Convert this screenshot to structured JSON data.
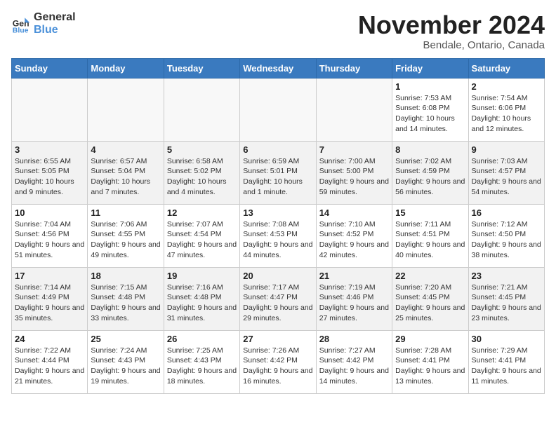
{
  "header": {
    "logo_line1": "General",
    "logo_line2": "Blue",
    "month_title": "November 2024",
    "location": "Bendale, Ontario, Canada"
  },
  "weekdays": [
    "Sunday",
    "Monday",
    "Tuesday",
    "Wednesday",
    "Thursday",
    "Friday",
    "Saturday"
  ],
  "weeks": [
    [
      {
        "day": "",
        "info": ""
      },
      {
        "day": "",
        "info": ""
      },
      {
        "day": "",
        "info": ""
      },
      {
        "day": "",
        "info": ""
      },
      {
        "day": "",
        "info": ""
      },
      {
        "day": "1",
        "info": "Sunrise: 7:53 AM\nSunset: 6:08 PM\nDaylight: 10 hours and 14 minutes."
      },
      {
        "day": "2",
        "info": "Sunrise: 7:54 AM\nSunset: 6:06 PM\nDaylight: 10 hours and 12 minutes."
      }
    ],
    [
      {
        "day": "3",
        "info": "Sunrise: 6:55 AM\nSunset: 5:05 PM\nDaylight: 10 hours and 9 minutes."
      },
      {
        "day": "4",
        "info": "Sunrise: 6:57 AM\nSunset: 5:04 PM\nDaylight: 10 hours and 7 minutes."
      },
      {
        "day": "5",
        "info": "Sunrise: 6:58 AM\nSunset: 5:02 PM\nDaylight: 10 hours and 4 minutes."
      },
      {
        "day": "6",
        "info": "Sunrise: 6:59 AM\nSunset: 5:01 PM\nDaylight: 10 hours and 1 minute."
      },
      {
        "day": "7",
        "info": "Sunrise: 7:00 AM\nSunset: 5:00 PM\nDaylight: 9 hours and 59 minutes."
      },
      {
        "day": "8",
        "info": "Sunrise: 7:02 AM\nSunset: 4:59 PM\nDaylight: 9 hours and 56 minutes."
      },
      {
        "day": "9",
        "info": "Sunrise: 7:03 AM\nSunset: 4:57 PM\nDaylight: 9 hours and 54 minutes."
      }
    ],
    [
      {
        "day": "10",
        "info": "Sunrise: 7:04 AM\nSunset: 4:56 PM\nDaylight: 9 hours and 51 minutes."
      },
      {
        "day": "11",
        "info": "Sunrise: 7:06 AM\nSunset: 4:55 PM\nDaylight: 9 hours and 49 minutes."
      },
      {
        "day": "12",
        "info": "Sunrise: 7:07 AM\nSunset: 4:54 PM\nDaylight: 9 hours and 47 minutes."
      },
      {
        "day": "13",
        "info": "Sunrise: 7:08 AM\nSunset: 4:53 PM\nDaylight: 9 hours and 44 minutes."
      },
      {
        "day": "14",
        "info": "Sunrise: 7:10 AM\nSunset: 4:52 PM\nDaylight: 9 hours and 42 minutes."
      },
      {
        "day": "15",
        "info": "Sunrise: 7:11 AM\nSunset: 4:51 PM\nDaylight: 9 hours and 40 minutes."
      },
      {
        "day": "16",
        "info": "Sunrise: 7:12 AM\nSunset: 4:50 PM\nDaylight: 9 hours and 38 minutes."
      }
    ],
    [
      {
        "day": "17",
        "info": "Sunrise: 7:14 AM\nSunset: 4:49 PM\nDaylight: 9 hours and 35 minutes."
      },
      {
        "day": "18",
        "info": "Sunrise: 7:15 AM\nSunset: 4:48 PM\nDaylight: 9 hours and 33 minutes."
      },
      {
        "day": "19",
        "info": "Sunrise: 7:16 AM\nSunset: 4:48 PM\nDaylight: 9 hours and 31 minutes."
      },
      {
        "day": "20",
        "info": "Sunrise: 7:17 AM\nSunset: 4:47 PM\nDaylight: 9 hours and 29 minutes."
      },
      {
        "day": "21",
        "info": "Sunrise: 7:19 AM\nSunset: 4:46 PM\nDaylight: 9 hours and 27 minutes."
      },
      {
        "day": "22",
        "info": "Sunrise: 7:20 AM\nSunset: 4:45 PM\nDaylight: 9 hours and 25 minutes."
      },
      {
        "day": "23",
        "info": "Sunrise: 7:21 AM\nSunset: 4:45 PM\nDaylight: 9 hours and 23 minutes."
      }
    ],
    [
      {
        "day": "24",
        "info": "Sunrise: 7:22 AM\nSunset: 4:44 PM\nDaylight: 9 hours and 21 minutes."
      },
      {
        "day": "25",
        "info": "Sunrise: 7:24 AM\nSunset: 4:43 PM\nDaylight: 9 hours and 19 minutes."
      },
      {
        "day": "26",
        "info": "Sunrise: 7:25 AM\nSunset: 4:43 PM\nDaylight: 9 hours and 18 minutes."
      },
      {
        "day": "27",
        "info": "Sunrise: 7:26 AM\nSunset: 4:42 PM\nDaylight: 9 hours and 16 minutes."
      },
      {
        "day": "28",
        "info": "Sunrise: 7:27 AM\nSunset: 4:42 PM\nDaylight: 9 hours and 14 minutes."
      },
      {
        "day": "29",
        "info": "Sunrise: 7:28 AM\nSunset: 4:41 PM\nDaylight: 9 hours and 13 minutes."
      },
      {
        "day": "30",
        "info": "Sunrise: 7:29 AM\nSunset: 4:41 PM\nDaylight: 9 hours and 11 minutes."
      }
    ]
  ]
}
